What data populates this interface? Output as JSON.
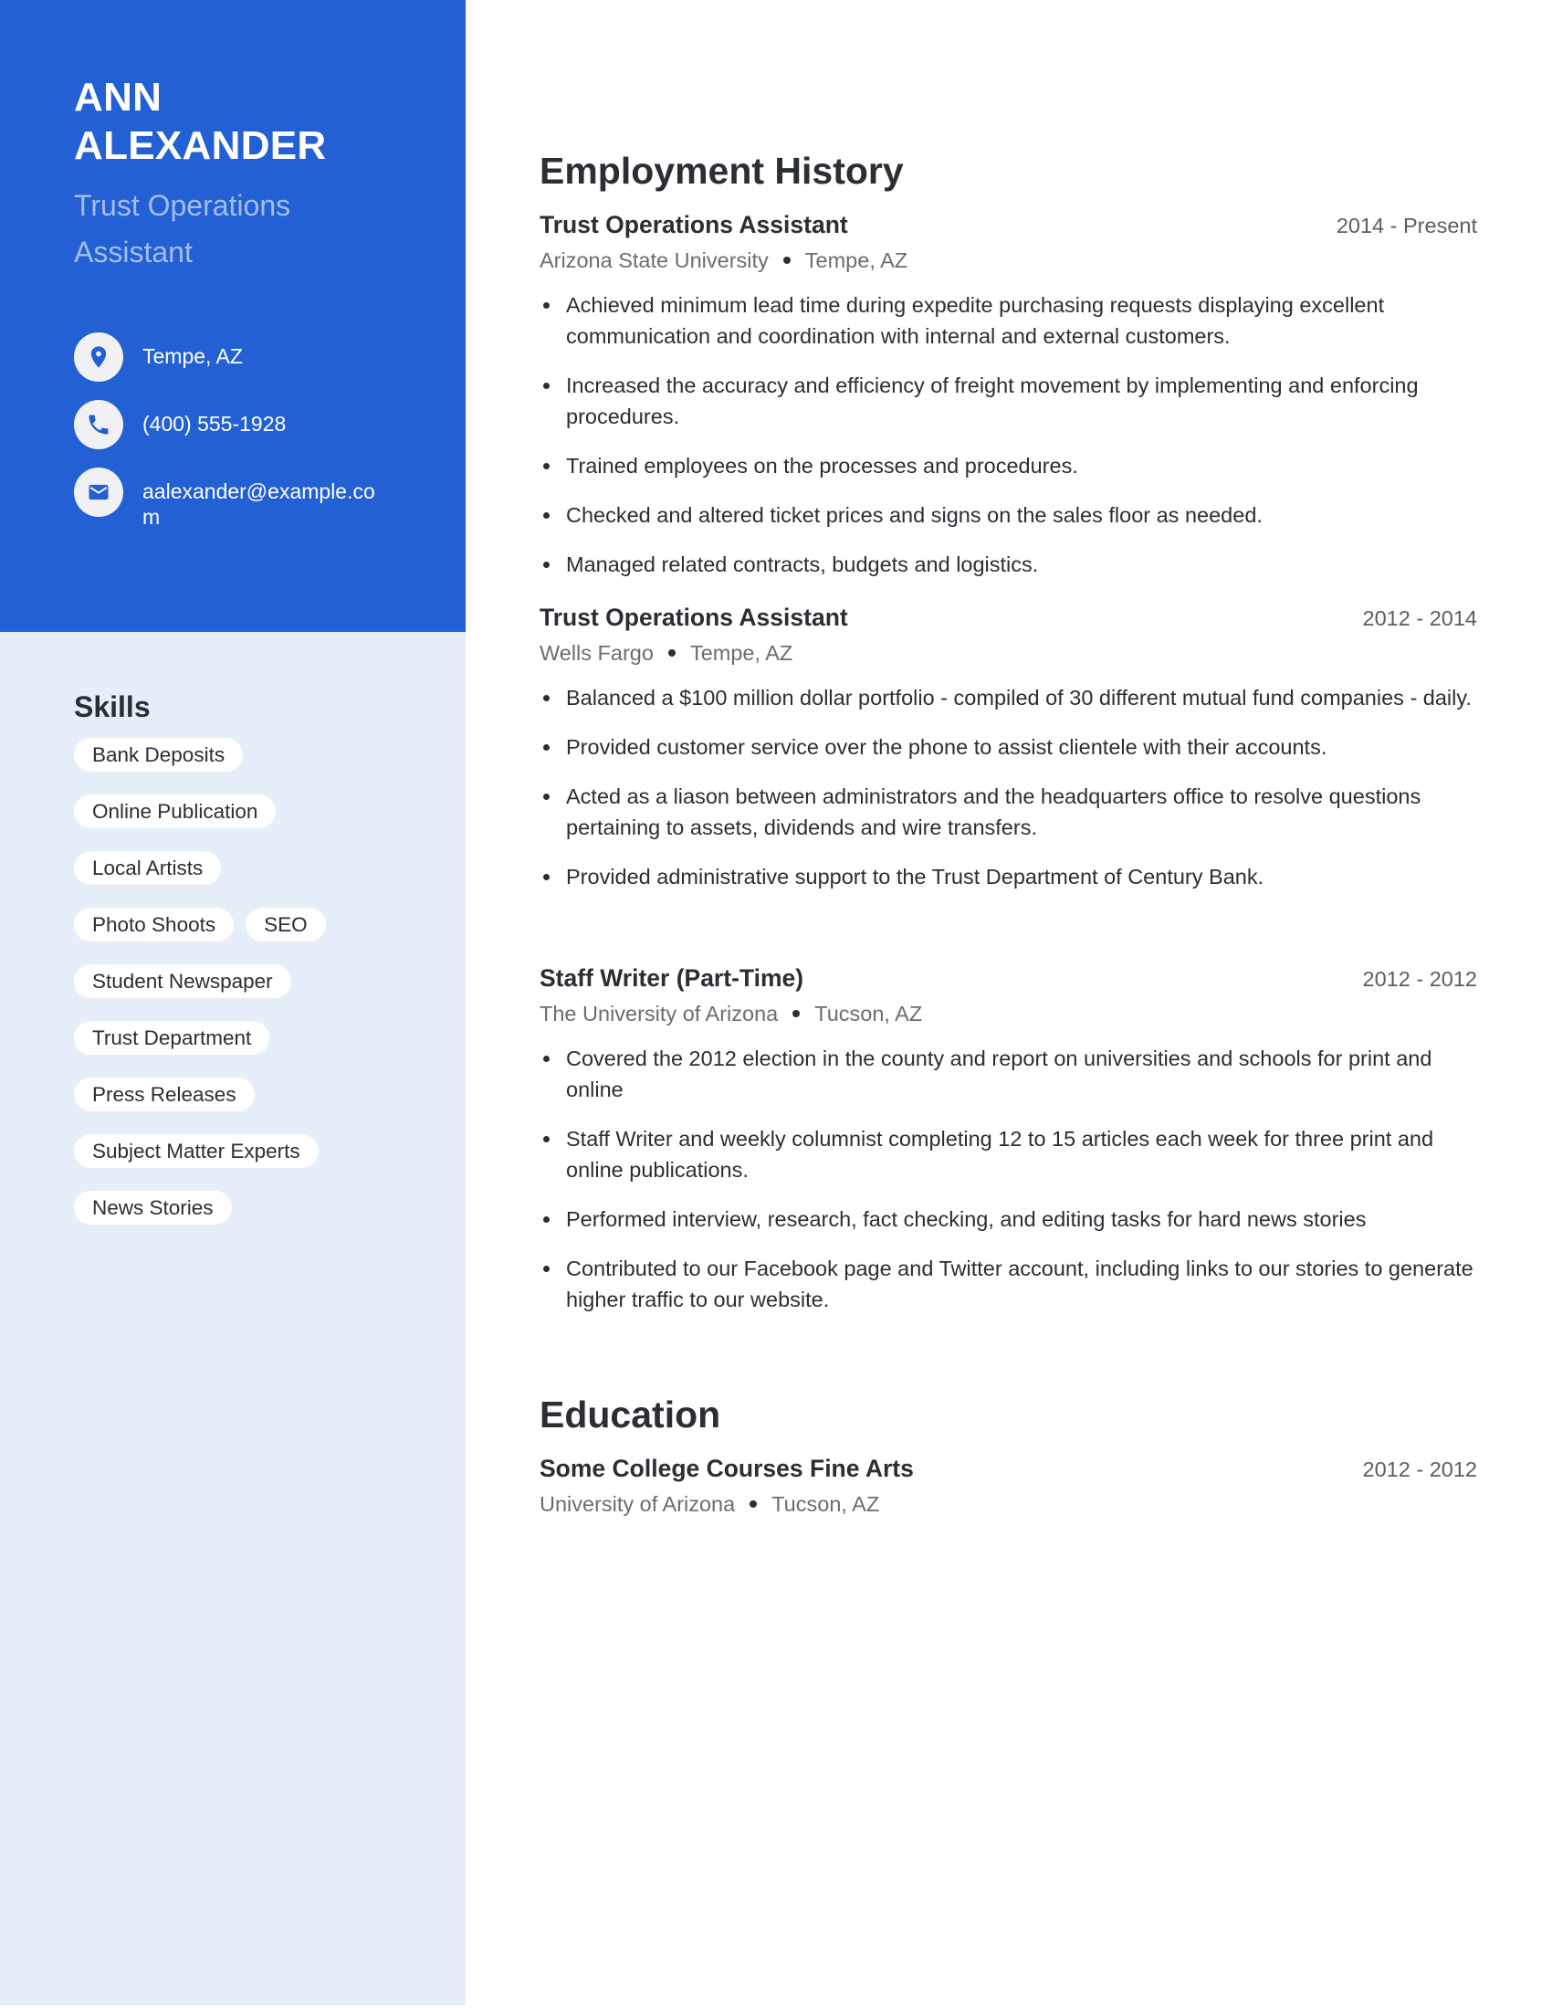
{
  "profile": {
    "first_name": "ANN",
    "last_name": "ALEXANDER",
    "title": "Trust Operations Assistant",
    "contacts": [
      {
        "icon": "location-pin-icon",
        "text": "Tempe, AZ"
      },
      {
        "icon": "phone-icon",
        "text": "(400) 555-1928"
      },
      {
        "icon": "mail-icon",
        "text": "aalexander@example.com"
      }
    ]
  },
  "skills": {
    "heading": "Skills",
    "items": [
      "Bank Deposits",
      "Online Publication",
      "Local Artists",
      "Photo Shoots",
      "SEO",
      "Student Newspaper",
      "Trust Department",
      "Press Releases",
      "Subject Matter Experts",
      "News Stories"
    ]
  },
  "employment": {
    "heading": "Employment History",
    "jobs": [
      {
        "title": "Trust Operations Assistant",
        "dates": "2014 - Present",
        "employer": "Arizona State University",
        "location": "Tempe, AZ",
        "bullets": [
          "Achieved minimum lead time during expedite purchasing requests displaying excellent communication and coordination with internal and external customers.",
          "Increased the accuracy and efficiency of freight movement by implementing and enforcing procedures.",
          "Trained employees on the processes and procedures.",
          "Checked and altered ticket prices and signs on the sales floor as needed.",
          "Managed related contracts, budgets and logistics."
        ]
      },
      {
        "title": "Trust Operations Assistant",
        "dates": "2012 - 2014",
        "employer": "Wells Fargo",
        "location": "Tempe, AZ",
        "bullets": [
          "Balanced a $100 million dollar portfolio - compiled of 30 different mutual fund companies - daily.",
          "Provided customer service over the phone to assist clientele with their accounts.",
          "Acted as a liason between administrators and the headquarters office to resolve questions pertaining to assets, dividends and wire transfers.",
          "Provided administrative support to the Trust Department of Century Bank."
        ]
      },
      {
        "title": "Staff Writer (Part-Time)",
        "dates": "2012 - 2012",
        "employer": "The University of Arizona",
        "location": "Tucson, AZ",
        "bullets": [
          "Covered the 2012 election in the county and report on universities and schools for print and online",
          "Staff Writer and weekly columnist completing 12 to 15 articles each week for three print and online publications.",
          "Performed interview, research, fact checking, and editing tasks for hard news stories",
          "Contributed to our Facebook page and Twitter account, including links to our stories to generate higher traffic to our website."
        ]
      }
    ]
  },
  "education": {
    "heading": "Education",
    "entries": [
      {
        "title": "Some College Courses Fine Arts",
        "dates": "2012 - 2012",
        "school": "University of Arizona",
        "location": "Tucson, AZ"
      }
    ]
  },
  "colors": {
    "accent": "#2260d4",
    "sidebar_bg": "#e6eef9",
    "subtitle": "#a3bdf0"
  }
}
